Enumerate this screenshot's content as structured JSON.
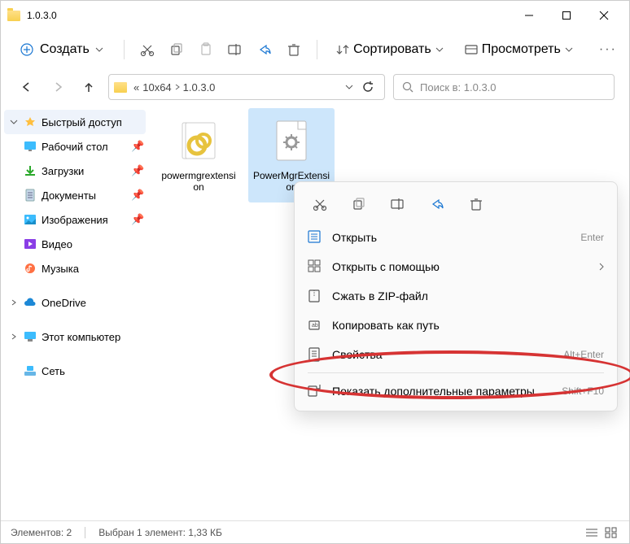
{
  "window": {
    "title": "1.0.3.0"
  },
  "toolbar": {
    "create_label": "Создать",
    "sort_label": "Сортировать",
    "view_label": "Просмотреть"
  },
  "breadcrumbs": {
    "prefix": "«",
    "part1": "10x64",
    "part2": "1.0.3.0"
  },
  "search": {
    "placeholder": "Поиск в: 1.0.3.0"
  },
  "sidebar": {
    "quick_access": "Быстрый доступ",
    "desktop": "Рабочий стол",
    "downloads": "Загрузки",
    "documents": "Документы",
    "pictures": "Изображения",
    "video": "Видео",
    "music": "Музыка",
    "onedrive": "OneDrive",
    "this_pc": "Этот компьютер",
    "network": "Сеть"
  },
  "files": {
    "item1": "powermgrextension",
    "item2": "PowerMgrExtension"
  },
  "context_menu": {
    "open": "Открыть",
    "open_hint": "Enter",
    "open_with": "Открыть с помощью",
    "compress": "Сжать в ZIP-файл",
    "copy_path": "Копировать как путь",
    "properties": "Свойства",
    "properties_hint": "Alt+Enter",
    "show_more": "Показать дополнительные параметры",
    "show_more_hint": "Shift+F10"
  },
  "status": {
    "count": "Элементов: 2",
    "selection": "Выбран 1 элемент: 1,33 КБ"
  }
}
